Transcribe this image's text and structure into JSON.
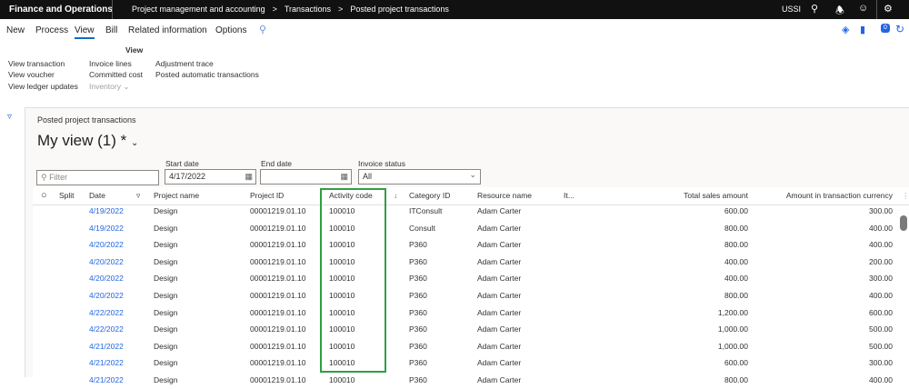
{
  "app_title": "Finance and Operations",
  "breadcrumb": [
    "Project management and accounting",
    "Transactions",
    "Posted project transactions"
  ],
  "company": "USSI",
  "action_tabs": [
    "New",
    "Process",
    "View",
    "Bill",
    "Related information",
    "Options"
  ],
  "active_tab": "View",
  "ribbon": {
    "group_title": "View",
    "col1": [
      "View transaction",
      "View voucher",
      "View ledger updates"
    ],
    "col2": [
      "Invoice lines",
      "Committed cost"
    ],
    "inventory": "Inventory",
    "col3": [
      "Adjustment trace",
      "Posted automatic transactions"
    ]
  },
  "notification_count": "0",
  "page": {
    "caption": "Posted project transactions",
    "view_name": "My view (1) *"
  },
  "filters": {
    "filter_placeholder": "Filter",
    "start_date_label": "Start date",
    "start_date": "4/17/2022",
    "end_date_label": "End date",
    "end_date": "",
    "invoice_status_label": "Invoice status",
    "invoice_status": "All"
  },
  "columns": {
    "split": "Split",
    "date": "Date",
    "project_name": "Project name",
    "project_id": "Project ID",
    "activity_code": "Activity code",
    "category_id": "Category ID",
    "resource_name": "Resource name",
    "item": "It...",
    "total_sales": "Total sales amount",
    "amount_currency": "Amount in transaction currency"
  },
  "rows": [
    [
      "4/19/2022",
      "Design",
      "00001219.01.10",
      "100010",
      "ITConsult",
      "Adam Carter",
      "600.00",
      "300.00"
    ],
    [
      "4/19/2022",
      "Design",
      "00001219.01.10",
      "100010",
      "Consult",
      "Adam Carter",
      "800.00",
      "400.00"
    ],
    [
      "4/20/2022",
      "Design",
      "00001219.01.10",
      "100010",
      "P360",
      "Adam Carter",
      "800.00",
      "400.00"
    ],
    [
      "4/20/2022",
      "Design",
      "00001219.01.10",
      "100010",
      "P360",
      "Adam Carter",
      "400.00",
      "200.00"
    ],
    [
      "4/20/2022",
      "Design",
      "00001219.01.10",
      "100010",
      "P360",
      "Adam Carter",
      "400.00",
      "300.00"
    ],
    [
      "4/20/2022",
      "Design",
      "00001219.01.10",
      "100010",
      "P360",
      "Adam Carter",
      "800.00",
      "400.00"
    ],
    [
      "4/22/2022",
      "Design",
      "00001219.01.10",
      "100010",
      "P360",
      "Adam Carter",
      "1,200.00",
      "600.00"
    ],
    [
      "4/22/2022",
      "Design",
      "00001219.01.10",
      "100010",
      "P360",
      "Adam Carter",
      "1,000.00",
      "500.00"
    ],
    [
      "4/21/2022",
      "Design",
      "00001219.01.10",
      "100010",
      "P360",
      "Adam Carter",
      "1,000.00",
      "500.00"
    ],
    [
      "4/21/2022",
      "Design",
      "00001219.01.10",
      "100010",
      "P360",
      "Adam Carter",
      "600.00",
      "300.00"
    ],
    [
      "4/21/2022",
      "Design",
      "00001219.01.10",
      "100010",
      "P360",
      "Adam Carter",
      "800.00",
      "400.00"
    ]
  ],
  "highlight_color": "#2ea043"
}
